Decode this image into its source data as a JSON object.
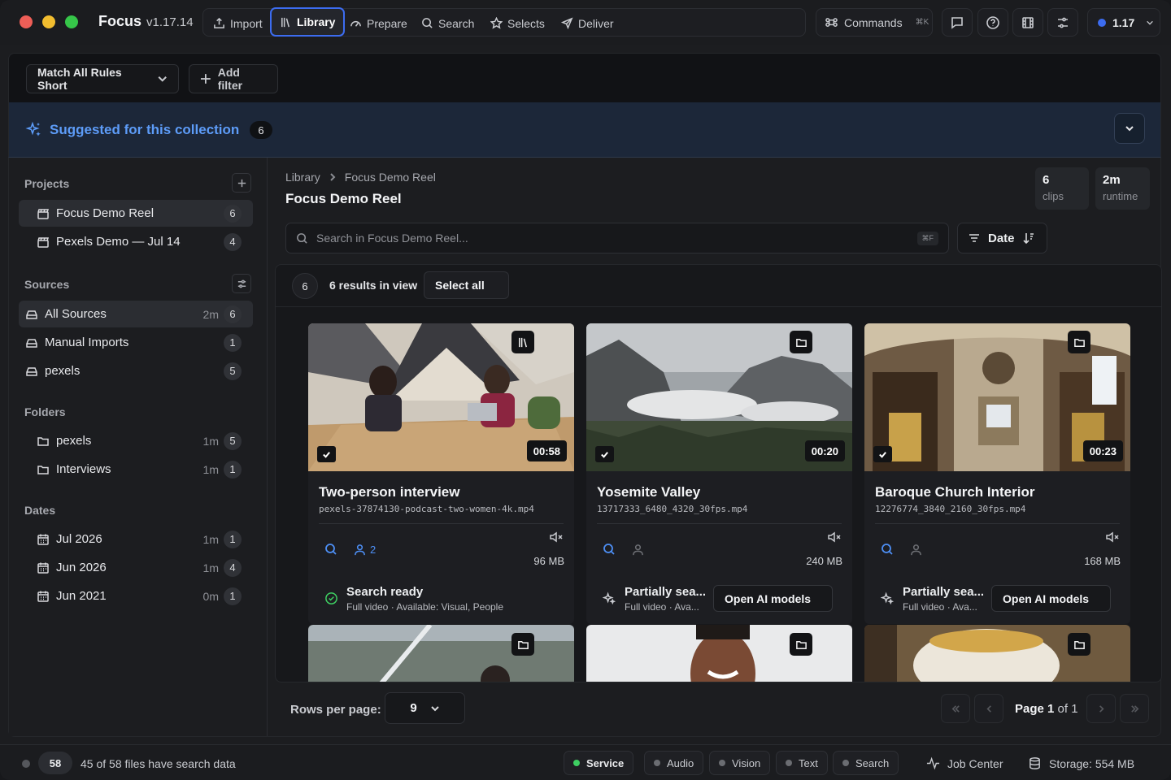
{
  "app": {
    "name": "Focus",
    "version": "v1.17.14"
  },
  "nav": {
    "items": [
      {
        "label": "Import",
        "icon": "upload-icon"
      },
      {
        "label": "Library",
        "icon": "library-icon",
        "active": true
      },
      {
        "label": "Prepare",
        "icon": "gauge-icon"
      },
      {
        "label": "Search",
        "icon": "search-icon"
      },
      {
        "label": "Selects",
        "icon": "star-icon"
      },
      {
        "label": "Deliver",
        "icon": "send-icon"
      }
    ],
    "commands_label": "Commands",
    "commands_shortcut": "⌘K",
    "version_badge": "1.17"
  },
  "filters": {
    "match_label": "Match All Rules Short",
    "add_filter_label": "Add filter"
  },
  "suggested": {
    "title": "Suggested for this collection",
    "count": "6"
  },
  "sidebar": {
    "projects_title": "Projects",
    "projects": [
      {
        "label": "Focus Demo Reel",
        "count": "6"
      },
      {
        "label": "Pexels Demo — Jul 14",
        "count": "4"
      }
    ],
    "sources_title": "Sources",
    "sources": [
      {
        "label": "All Sources",
        "meta": "2m",
        "count": "6"
      },
      {
        "label": "Manual Imports",
        "meta": "",
        "count": "1"
      },
      {
        "label": "pexels",
        "meta": "",
        "count": "5"
      }
    ],
    "folders_title": "Folders",
    "folders": [
      {
        "label": "pexels",
        "meta": "1m",
        "count": "5"
      },
      {
        "label": "Interviews",
        "meta": "1m",
        "count": "1"
      }
    ],
    "dates_title": "Dates",
    "dates": [
      {
        "label": "Jul 2026",
        "meta": "1m",
        "count": "1"
      },
      {
        "label": "Jun 2026",
        "meta": "1m",
        "count": "4"
      },
      {
        "label": "Jun 2021",
        "meta": "0m",
        "count": "1"
      }
    ]
  },
  "main": {
    "breadcrumb": [
      "Library",
      "Focus Demo Reel"
    ],
    "title": "Focus Demo Reel",
    "stats": [
      {
        "value": "6",
        "label": "clips"
      },
      {
        "value": "2m",
        "label": "runtime"
      }
    ],
    "search_placeholder": "Search in Focus Demo Reel...",
    "search_shortcut": "⌘F",
    "sort_label": "Date",
    "results_count": "6",
    "results_text": "6 results in view",
    "select_all_label": "Select all"
  },
  "cards": [
    {
      "title": "Two-person interview",
      "file": "pexels-37874130-podcast-two-women-4k.mp4",
      "duration": "00:58",
      "people": "2",
      "size": "96 MB",
      "status_title": "Search ready",
      "status_sub": "Full video · Available: Visual, People",
      "ready": true,
      "badge_icon": "library-icon"
    },
    {
      "title": "Yosemite Valley",
      "file": "13717333_6480_4320_30fps.mp4",
      "duration": "00:20",
      "people": "",
      "size": "240 MB",
      "status_title": "Partially sea...",
      "status_sub": "Full video · Ava...",
      "ready": false,
      "badge_icon": "folder-icon",
      "action_label": "Open AI models"
    },
    {
      "title": "Baroque Church Interior",
      "file": "12276774_3840_2160_30fps.mp4",
      "duration": "00:23",
      "people": "",
      "size": "168 MB",
      "status_title": "Partially sea...",
      "status_sub": "Full video · Ava...",
      "ready": false,
      "badge_icon": "folder-icon",
      "action_label": "Open AI models"
    }
  ],
  "pagination": {
    "rows_label": "Rows per page:",
    "rows_value": "9",
    "page_word": "Page",
    "page_current": "1",
    "page_of": "of",
    "page_total": "1"
  },
  "statusbar": {
    "files_count": "58",
    "files_text": "45 of 58 files have search data",
    "chips": [
      {
        "label": "Service",
        "active": true
      },
      {
        "label": "Audio",
        "active": false
      },
      {
        "label": "Vision",
        "active": false
      },
      {
        "label": "Text",
        "active": false
      },
      {
        "label": "Search",
        "active": false
      }
    ],
    "job_center": "Job Center",
    "storage": "Storage: 554 MB"
  },
  "colors": {
    "accent": "#3c6cf0",
    "link_blue": "#5d9cf8",
    "ok_green": "#3ecf62"
  }
}
